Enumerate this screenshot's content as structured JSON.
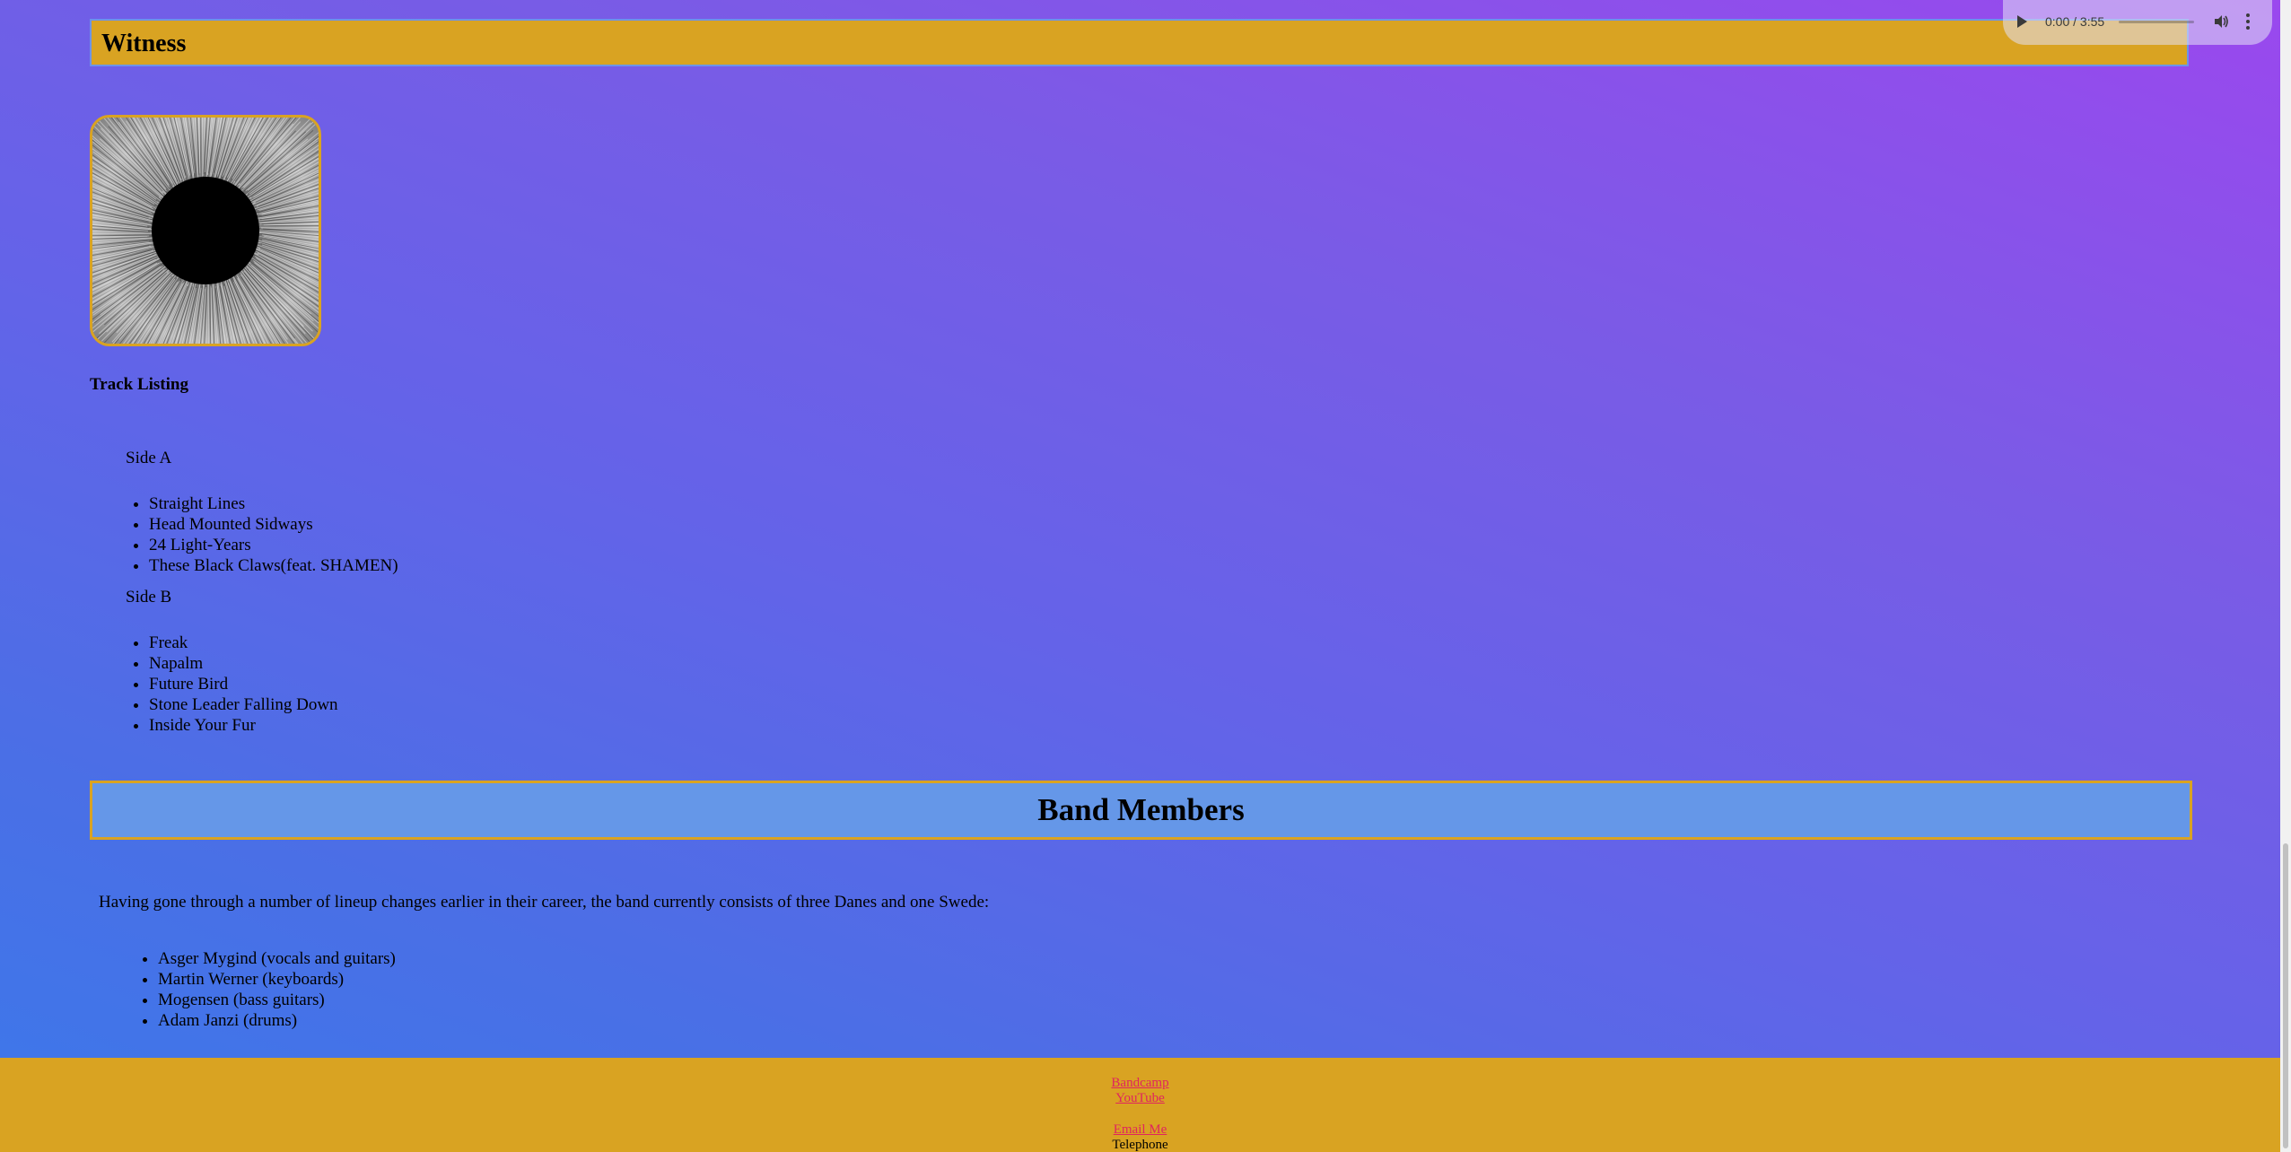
{
  "album": {
    "title": "Witness",
    "track_heading": "Track Listing",
    "side_a": {
      "label": "Side A",
      "tracks": [
        "Straight Lines",
        "Head Mounted Sidways",
        "24 Light-Years",
        "These Black Claws(feat. SHAMEN)"
      ]
    },
    "side_b": {
      "label": "Side B",
      "tracks": [
        "Freak",
        "Napalm",
        "Future Bird",
        "Stone Leader Falling Down",
        "Inside Your Fur"
      ]
    }
  },
  "band": {
    "heading": "Band Members",
    "intro": "Having gone through a number of lineup changes earlier in their career, the band currently consists of three Danes and one Swede:",
    "members": [
      "Asger Mygind (vocals and guitars)",
      "Martin Werner (keyboards)",
      "Mogensen (bass guitars)",
      "Adam Janzi (drums)"
    ]
  },
  "footer": {
    "links": [
      "Bandcamp",
      "YouTube"
    ],
    "email_label": "Email Me",
    "telephone_label": "Telephone"
  },
  "audio_player": {
    "time": "0:00 / 3:55",
    "progress": 0
  },
  "colors": {
    "accent_gold": "#d9a322",
    "link": "#e0245e",
    "header_blue": "#6597e8"
  }
}
